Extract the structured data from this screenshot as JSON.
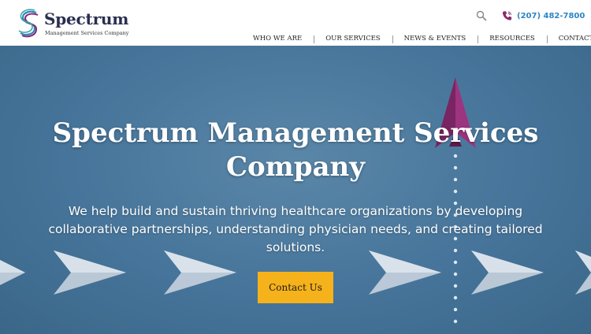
{
  "header": {
    "logo": {
      "title": "Spectrum",
      "subtitle": "Management Services Company"
    },
    "search_icon": "search-icon",
    "phone": {
      "icon": "phone-icon",
      "number": "(207) 482-7800"
    },
    "nav": [
      {
        "label": "WHO WE ARE"
      },
      {
        "label": "OUR SERVICES"
      },
      {
        "label": "NEWS & EVENTS"
      },
      {
        "label": "RESOURCES"
      },
      {
        "label": "CONTACT"
      }
    ]
  },
  "hero": {
    "title_line1": "Spectrum Management Services",
    "title_line2": "Company",
    "text": "We help build and sustain thriving healthcare organizations by developing collaborative partnerships, understanding physician needs, and creating tailored solutions.",
    "cta_label": "Contact Us"
  },
  "colors": {
    "accent": "#2b86c5",
    "cta": "#f6b21b",
    "hero_bg": "#46749a",
    "paper_plane_lead": "#8a2a6e"
  }
}
